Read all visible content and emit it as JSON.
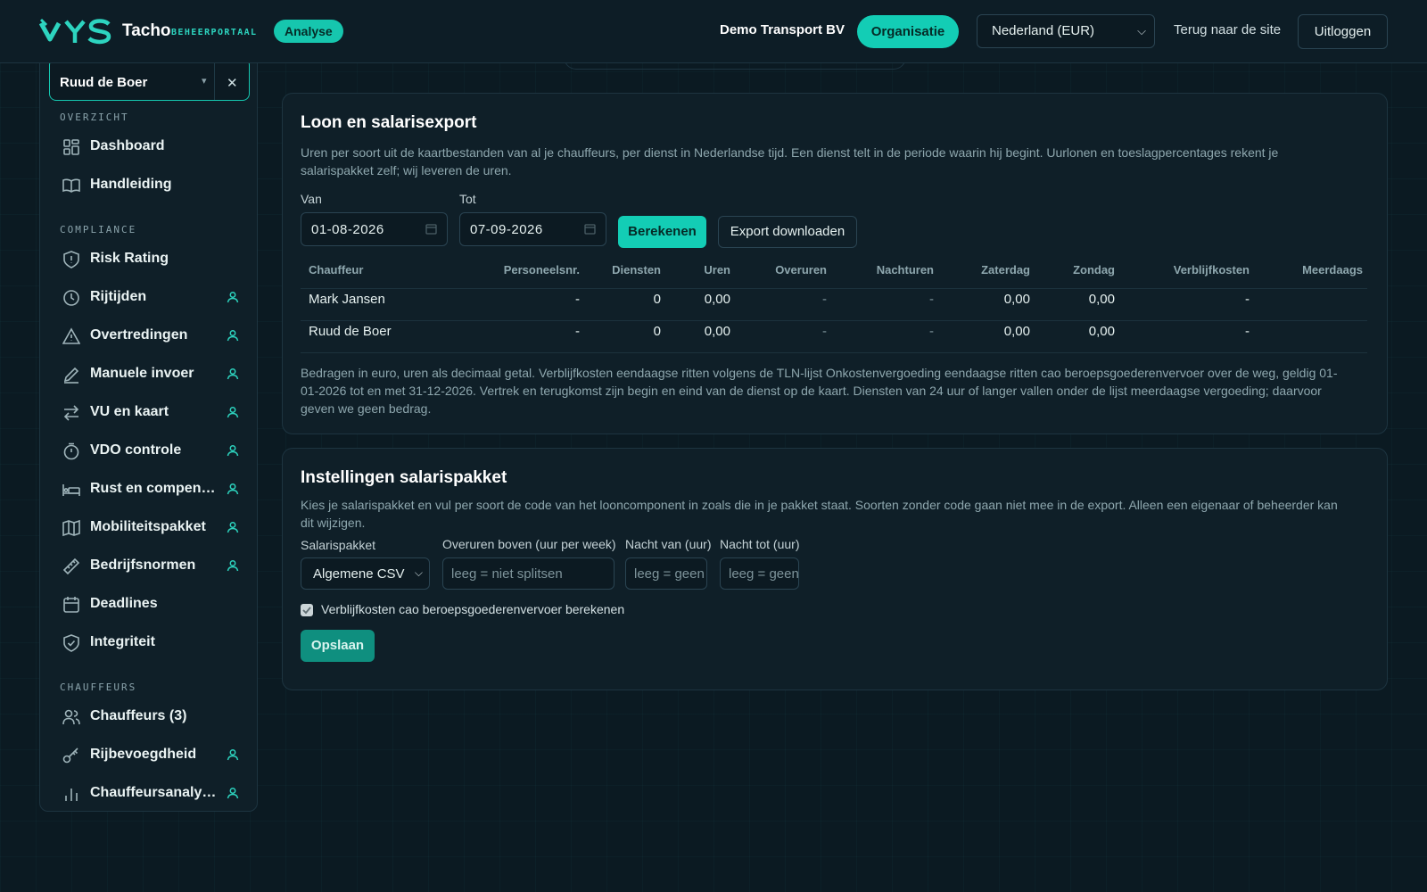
{
  "header": {
    "brand": "Tacho",
    "brand_sub": "BEHEERPORTAAL",
    "analyse_pill": "Analyse",
    "org_name": "Demo Transport BV",
    "org_button": "Organisatie",
    "country_select": "Nederland (EUR)",
    "back_link": "Terug naar de site",
    "logout": "Uitloggen"
  },
  "sidebar": {
    "driver_select": "Ruud de Boer",
    "sections": [
      "OVERZICHT",
      "COMPLIANCE",
      "CHAUFFEURS"
    ],
    "items": [
      {
        "label": "Dashboard",
        "icon": "dashboard-icon",
        "user": false
      },
      {
        "label": "Handleiding",
        "icon": "book-icon",
        "user": false
      },
      {
        "label": "Risk Rating",
        "icon": "shield-icon",
        "user": false
      },
      {
        "label": "Rijtijden",
        "icon": "clock-icon",
        "user": true
      },
      {
        "label": "Overtredingen",
        "icon": "warning-icon",
        "user": true
      },
      {
        "label": "Manuele invoer",
        "icon": "pencil-icon",
        "user": true
      },
      {
        "label": "VU en kaart",
        "icon": "swap-icon",
        "user": true
      },
      {
        "label": "VDO controle",
        "icon": "timer-icon",
        "user": true
      },
      {
        "label": "Rust en compen…",
        "icon": "bed-icon",
        "user": true
      },
      {
        "label": "Mobiliteitspakket",
        "icon": "map-icon",
        "user": true
      },
      {
        "label": "Bedrijfsnormen",
        "icon": "ruler-icon",
        "user": true
      },
      {
        "label": "Deadlines",
        "icon": "calendar-icon",
        "user": false
      },
      {
        "label": "Integriteit",
        "icon": "shield-check-icon",
        "user": false
      },
      {
        "label": "Chauffeurs (3)",
        "icon": "users-icon",
        "user": false
      },
      {
        "label": "Rijbevoegdheid",
        "icon": "key-icon",
        "user": true
      },
      {
        "label": "Chauffeursanaly…",
        "icon": "bar-chart-icon",
        "user": true
      }
    ]
  },
  "export": {
    "title": "Loon en salarisexport",
    "description": "Uren per soort uit de kaartbestanden van al je chauffeurs, per dienst in Nederlandse tijd. Een dienst telt in de periode waarin hij begint. Uurlonen en toeslagpercentages rekent je salarispakket zelf; wij leveren de uren.",
    "from_label": "Van",
    "from_value": "01-08-2026",
    "to_label": "Tot",
    "to_value": "07-09-2026",
    "calculate_button": "Berekenen",
    "download_button": "Export downloaden",
    "columns": [
      "Chauffeur",
      "Personeelsnr.",
      "Diensten",
      "Uren",
      "Overuren",
      "Nachturen",
      "Zaterdag",
      "Zondag",
      "Verblijfkosten",
      "Meerdaags"
    ],
    "rows": [
      [
        "Mark Jansen",
        "-",
        "0",
        "0,00",
        "-",
        "-",
        "0,00",
        "0,00",
        "-",
        ""
      ],
      [
        "Ruud de Boer",
        "-",
        "0",
        "0,00",
        "-",
        "-",
        "0,00",
        "0,00",
        "-",
        ""
      ]
    ],
    "footnote": "Bedragen in euro, uren als decimaal getal. Verblijfkosten eendaagse ritten volgens de TLN-lijst Onkostenvergoeding eendaagse ritten cao beroepsgoederenvervoer over de weg, geldig 01-01-2026 tot en met 31-12-2026. Vertrek en terugkomst zijn begin en eind van de dienst op de kaart. Diensten van 24 uur of langer vallen onder de lijst meerdaagse vergoeding; daarvoor geven we geen bedrag."
  },
  "settings": {
    "title": "Instellingen salarispakket",
    "description": "Kies je salarispakket en vul per soort de code van het looncomponent in zoals die in je pakket staat. Soorten zonder code gaan niet mee in de export. Alleen een eigenaar of beheerder kan dit wijzigen.",
    "package_label": "Salarispakket",
    "package_value": "Algemene CSV",
    "overtime_label": "Overuren boven (uur per week)",
    "overtime_placeholder": "leeg = niet splitsen",
    "night_from_label": "Nacht van (uur)",
    "night_from_placeholder": "leeg = geen",
    "night_to_label": "Nacht tot (uur)",
    "night_to_placeholder": "leeg = geen",
    "checkbox_label": "Verblijfkosten cao beroepsgoederenvervoer berekenen",
    "checkbox_checked": true,
    "save_button": "Opslaan"
  },
  "colors": {
    "accent": "#13cdb5",
    "background": "#0b1a22",
    "panel": "#0f1f28",
    "border": "#1d3440"
  }
}
